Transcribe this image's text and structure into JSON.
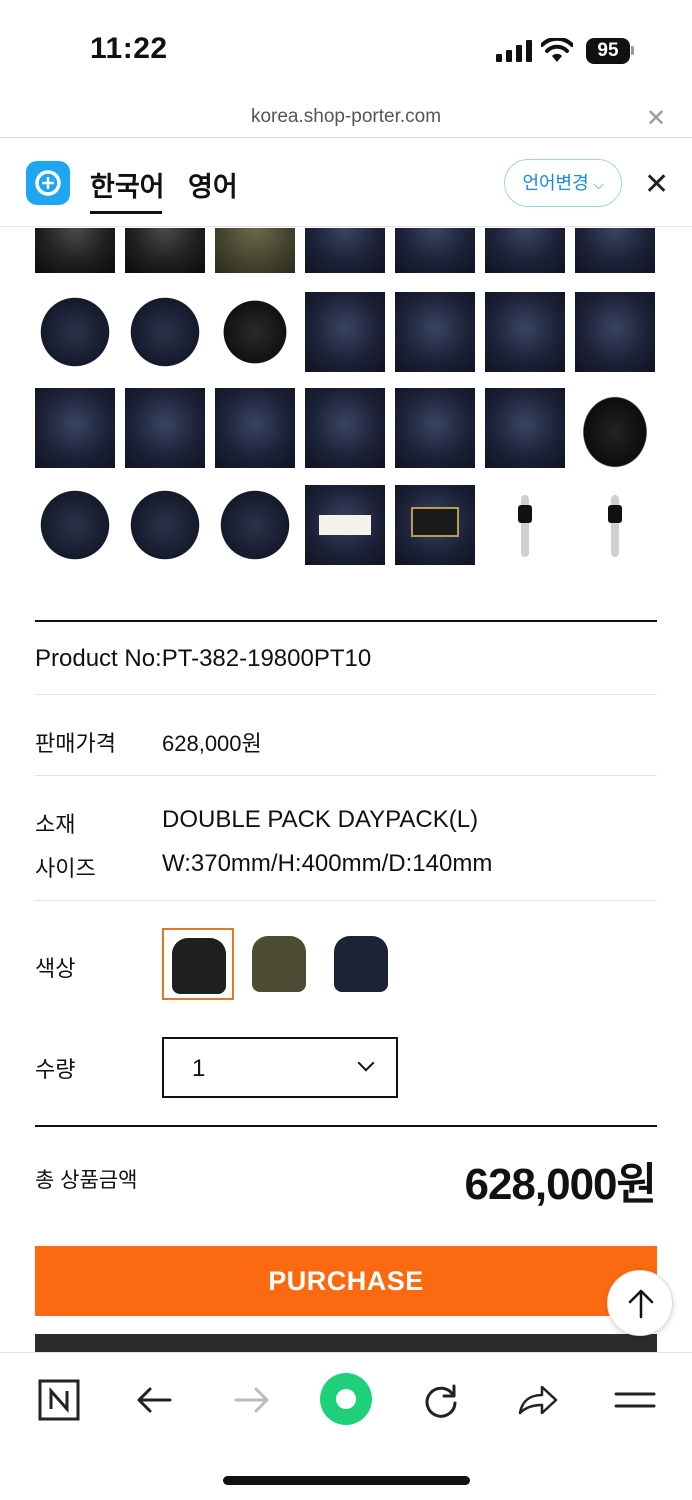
{
  "status_bar": {
    "time": "11:22",
    "battery": "95"
  },
  "browser": {
    "url": "korea.shop-porter.com"
  },
  "translate_bar": {
    "lang_source": "한국어",
    "lang_target": "영어",
    "change_label": "언어변경"
  },
  "product": {
    "product_no": "Product No:PT-382-19800PT10",
    "price_label": "판매가격",
    "price_value": "628,000원",
    "material_label": "소재",
    "material_value": "DOUBLE PACK DAYPACK(L)",
    "size_label": "사이즈",
    "size_value": "W:370mm/H:400mm/D:140mm",
    "color_label": "색상",
    "color_options": [
      {
        "name": "black",
        "color": "#1f1f1f"
      },
      {
        "name": "olive",
        "color": "#4d4c35"
      },
      {
        "name": "navy",
        "color": "#1d2336"
      }
    ],
    "quantity_label": "수량",
    "quantity_value": "1",
    "total_label": "총 상품금액",
    "total_value": "628,000원"
  },
  "actions": {
    "purchase_label": "PURCHASE"
  },
  "colors": {
    "accent": "#fb6a10",
    "selected_border": "#e07a2a",
    "translate_blue": "#1b8be0"
  }
}
